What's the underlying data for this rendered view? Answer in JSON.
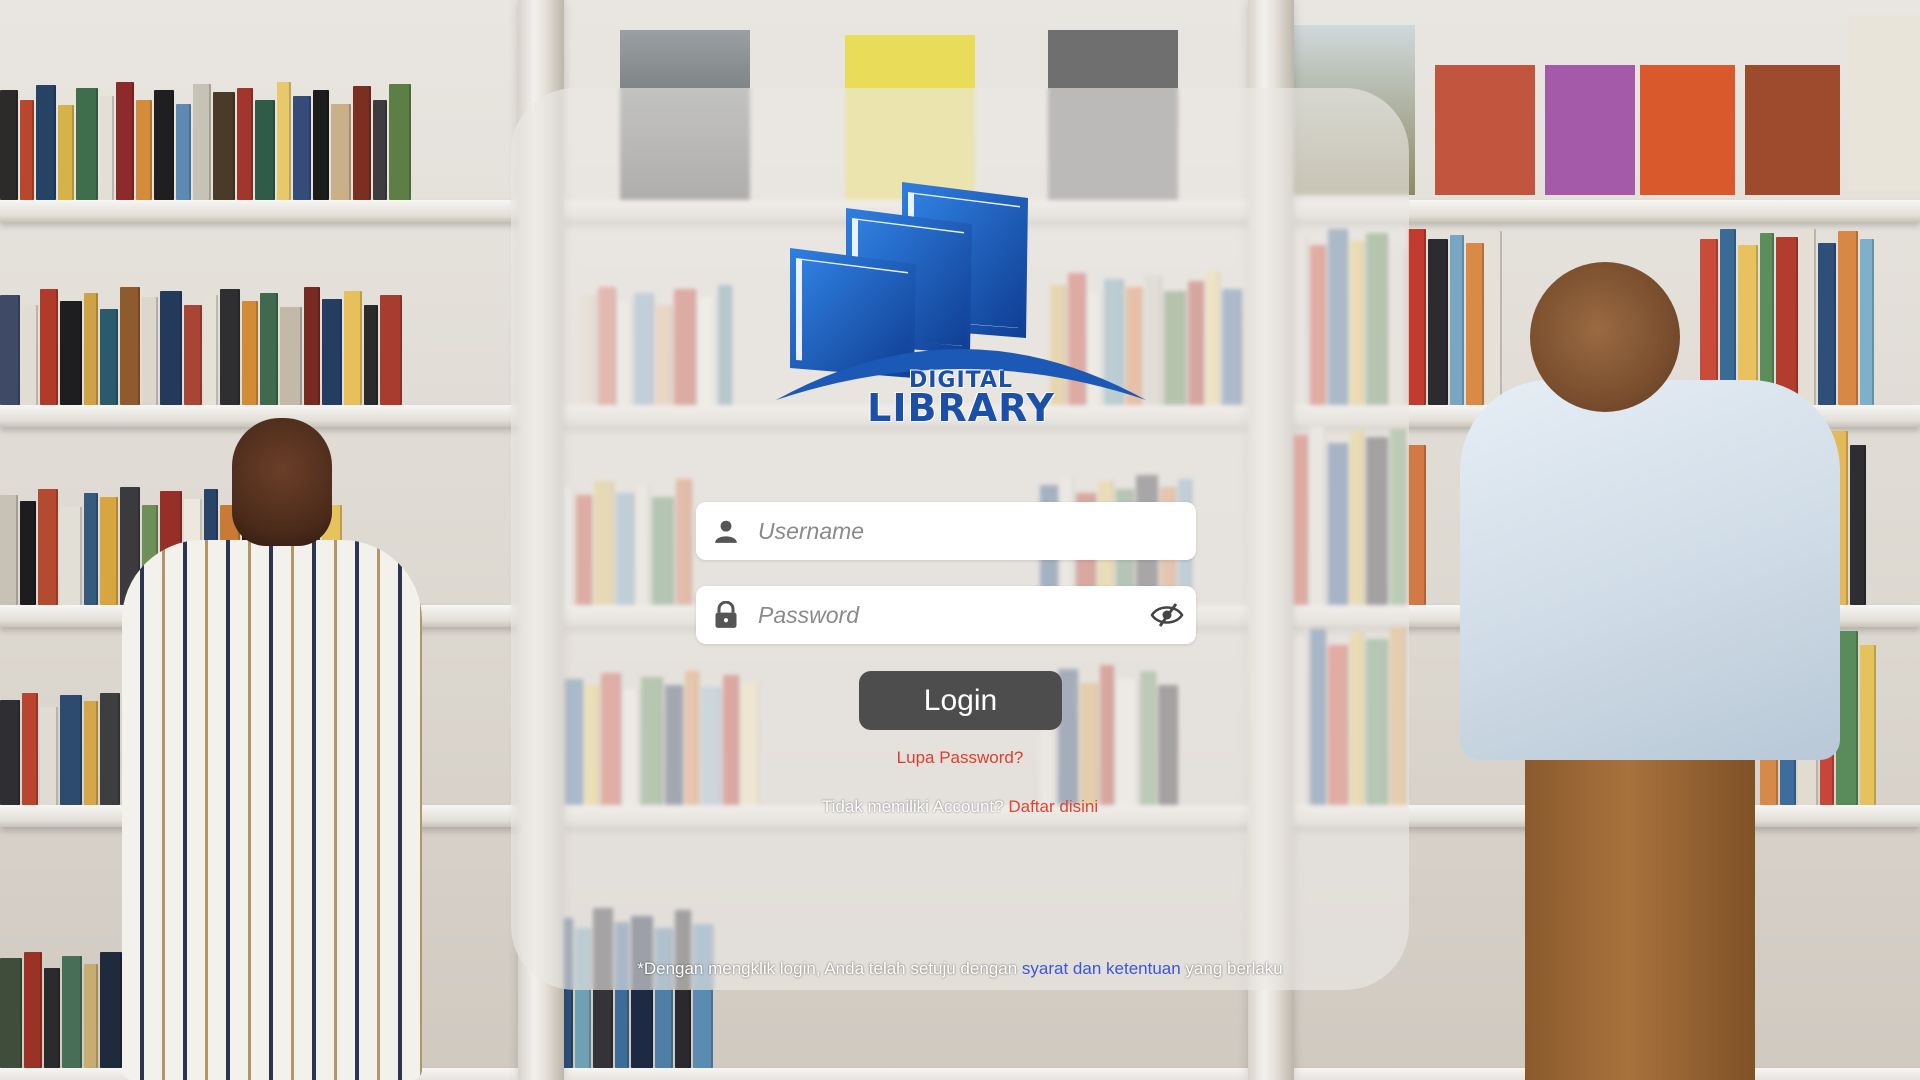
{
  "brand": {
    "logo_line1": "DIGITAL",
    "logo_line2": "LIBRARY",
    "primary_color": "#1b4fa8"
  },
  "form": {
    "username": {
      "placeholder": "Username",
      "value": "",
      "icon": "user-icon"
    },
    "password": {
      "placeholder": "Password",
      "value": "",
      "icon": "lock-icon",
      "toggle_icon": "eye-slash-icon"
    },
    "login_label": "Login",
    "forgot_label": "Lupa Password?",
    "register_prefix": "Tidak memiliki Account?",
    "register_link": "Daftar disini"
  },
  "terms": {
    "prefix": "*Dengan mengklik login, Anda telah setuju dengan",
    "link": "syarat dan ketentuan",
    "suffix": "yang berlaku"
  },
  "colors": {
    "button": "#4d4d4d",
    "link_red": "#d9412f",
    "link_blue": "#3a57d6"
  }
}
